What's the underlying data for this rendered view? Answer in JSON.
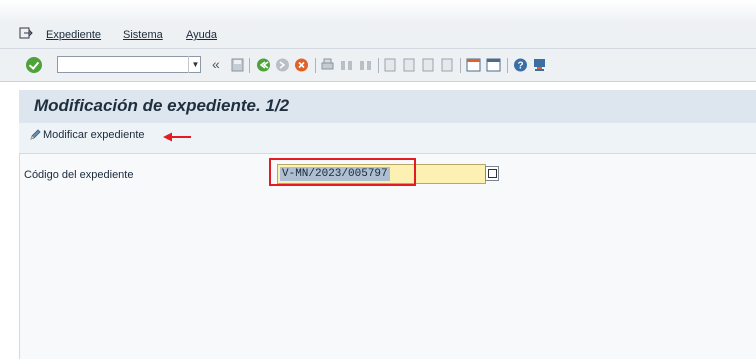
{
  "menu": {
    "items": [
      {
        "label": "Expediente"
      },
      {
        "label": "Sistema"
      },
      {
        "label": "Ayuda"
      }
    ]
  },
  "toolbar": {
    "command_value": "",
    "icons": [
      "enter-icon",
      "command-dropdown-icon",
      "collapse-icon",
      "save-icon",
      "back-icon",
      "exit-icon",
      "cancel-icon",
      "print-icon",
      "find-icon",
      "find-next-icon",
      "first-page-icon",
      "previous-page-icon",
      "next-page-icon",
      "last-page-icon",
      "create-session-icon",
      "shortcut-icon",
      "help-icon",
      "customize-layout-icon"
    ]
  },
  "screen": {
    "title": "Modificación de expediente. 1/2"
  },
  "actions": {
    "modify_label": "Modificar expediente"
  },
  "form": {
    "field_label": "Código del expediente",
    "field_value": "V-MN/2023/005797"
  },
  "colors": {
    "accent_red": "#e31c23",
    "title_bg": "#dde6ee",
    "input_bg": "#fdf0b3",
    "selection_bg": "#aebfd1"
  }
}
